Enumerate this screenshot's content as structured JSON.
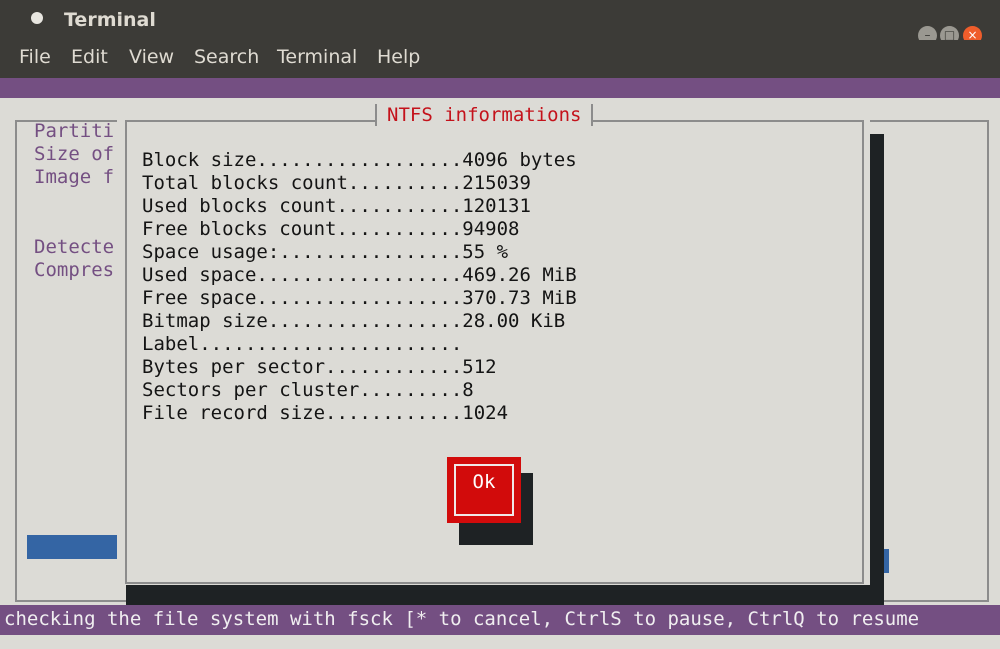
{
  "window": {
    "title": "Terminal",
    "controls": {
      "minimize": "–",
      "maximize": "□",
      "close": "×"
    }
  },
  "menu": [
    "File",
    "Edit",
    "View",
    "Search",
    "Terminal",
    "Help"
  ],
  "background_text": {
    "lines": [
      "Partiti",
      "Size of",
      "Image f",
      "Detecte",
      "Compres"
    ]
  },
  "dialog": {
    "title": "NTFS informations",
    "rows": [
      "Block size..................4096 bytes",
      "Total blocks count..........215039",
      "Used blocks count...........120131",
      "Free blocks count...........94908",
      "Space usage:................55 %",
      "Used space..................469.26 MiB",
      "Free space..................370.73 MiB",
      "Bitmap size.................28.00 KiB",
      "Label.......................",
      "Bytes per sector............512",
      "Sectors per cluster.........8",
      "File record size............1024"
    ],
    "ok_label": "Ok"
  },
  "status_line": "checking the file system with fsck [* to cancel, CtrlS to pause, CtrlQ to resume"
}
